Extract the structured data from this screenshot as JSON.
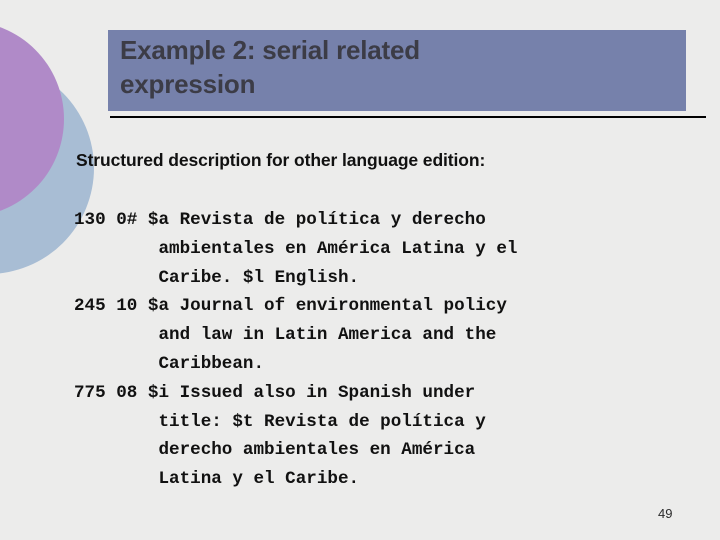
{
  "slide": {
    "background_color": "#ececeb",
    "page_number": "49"
  },
  "decoration": {
    "circle_purple_color": "#b08ac8",
    "circle_blue_color": "#a8bdd4"
  },
  "title": {
    "banner_color": "#7681ab",
    "text_color": "#3c3c46",
    "text": "Example 2:  serial related\nexpression"
  },
  "body": {
    "intro": "Structured description for other language edition:",
    "marc_record_text": "130 0# $a Revista de política y derecho\n        ambientales en América Latina y el\n        Caribe. $l English.\n245 10 $a Journal of environmental policy\n        and law in Latin America and the\n        Caribbean.\n775 08 $i Issued also in Spanish under\n        title: $t Revista de política y\n        derecho ambientales en América\n        Latina y el Caribe.",
    "marc_lines": [
      "130 0# $a Revista de política y derecho",
      "        ambientales en América Latina y el",
      "        Caribe. $l English.",
      "245 10 $a Journal of environmental policy",
      "        and law in Latin America and the",
      "        Caribbean.",
      "775 08 $i Issued also in Spanish under",
      "        title: $t Revista de política y",
      "        derecho ambientales en América",
      "        Latina y el Caribe."
    ]
  }
}
